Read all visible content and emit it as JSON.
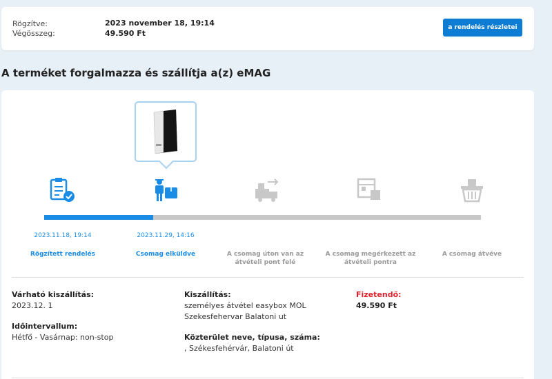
{
  "summary": {
    "registered_label": "Rögzítve:",
    "registered_value": "2023 november 18, 19:14",
    "total_label": "Végösszeg:",
    "total_value": "49.590 Ft",
    "details_button": "a rendelés részletei"
  },
  "section_title": "A terméket forgalmazza és szállítja a(z) eMAG",
  "tracking": {
    "progress_fraction": 0.25,
    "steps": [
      {
        "date": "2023.11.18, 19:14",
        "label": "Rögzített rendelés",
        "done": true,
        "icon": "clipboard-check-icon"
      },
      {
        "date": "2023.11.29, 14:16",
        "label": "Csomag elküldve",
        "done": true,
        "icon": "courier-package-icon"
      },
      {
        "date": "",
        "label": "A csomag úton van az átvételi pont felé",
        "done": false,
        "icon": "delivery-truck-icon"
      },
      {
        "date": "",
        "label": "A csomag megérkezett az átvételi pontra",
        "done": false,
        "icon": "pickup-point-icon"
      },
      {
        "date": "",
        "label": "A csomag átvéve",
        "done": false,
        "icon": "basket-icon"
      }
    ]
  },
  "info": {
    "delivery_expected_label": "Várható kiszállítás:",
    "delivery_expected_value": "2023.12. 1",
    "interval_label": "Időintervallum:",
    "interval_value": "Hétfő - Vasárnap: non-stop",
    "shipping_label": "Kiszállítás:",
    "shipping_line1": "személyes átvétel easybox MOL",
    "shipping_line2": "Szekesfehervar Balatoni ut",
    "address_label": "Közterület neve, típusa, száma:",
    "address_value": ", Székesfehérvár, Balatoni út",
    "payable_label": "Fizetendő:",
    "payable_value": "49.590 Ft"
  },
  "colors": {
    "accent": "#1a8ce6",
    "button": "#0d7cd3",
    "payable": "#e0202a",
    "inactive": "#c8c8c8"
  }
}
